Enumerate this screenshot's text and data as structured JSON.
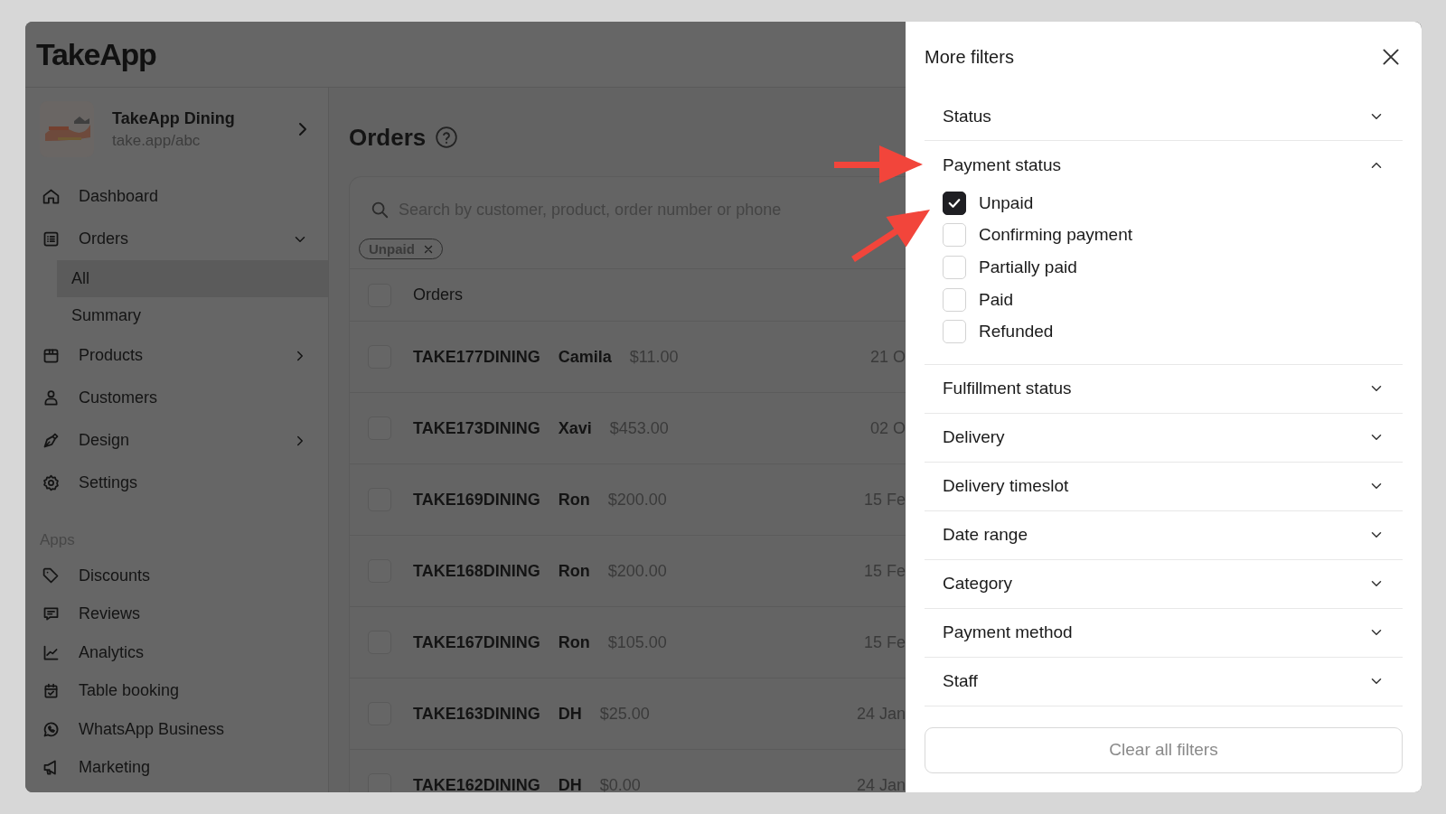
{
  "app": {
    "logo": "TakeApp"
  },
  "store": {
    "name": "TakeApp Dining",
    "url": "take.app/abc"
  },
  "sidebar": {
    "items": [
      {
        "label": "Dashboard",
        "selected": false
      },
      {
        "label": "Orders",
        "selected": false,
        "expanded": true,
        "children": [
          {
            "label": "All",
            "selected": true
          },
          {
            "label": "Summary",
            "selected": false
          }
        ]
      },
      {
        "label": "Products",
        "selected": false,
        "expanded": false
      },
      {
        "label": "Customers",
        "selected": false
      },
      {
        "label": "Design",
        "selected": false,
        "expanded": false
      },
      {
        "label": "Settings",
        "selected": false
      }
    ],
    "apps": {
      "heading": "Apps",
      "items": [
        {
          "label": "Discounts",
          "selected": false
        },
        {
          "label": "Reviews",
          "selected": false
        },
        {
          "label": "Analytics",
          "selected": false
        },
        {
          "label": "Table booking",
          "selected": false
        },
        {
          "label": "WhatsApp Business",
          "selected": false
        },
        {
          "label": "Marketing",
          "selected": false
        }
      ]
    }
  },
  "orders": {
    "title": "Orders",
    "search": {
      "placeholder": "Search by customer, product, order number or phone"
    },
    "chips": [
      {
        "label": "Unpaid"
      }
    ],
    "table": {
      "header": {
        "label": "Orders",
        "checked": false
      },
      "rows": [
        {
          "order": "TAKE177DINING",
          "customer": "Camila",
          "total": "$11.00",
          "date": "21 O",
          "checked": false
        },
        {
          "order": "TAKE173DINING",
          "customer": "Xavi",
          "total": "$453.00",
          "date": "02 O",
          "checked": false
        },
        {
          "order": "TAKE169DINING",
          "customer": "Ron",
          "total": "$200.00",
          "date": "15 Fe",
          "checked": false
        },
        {
          "order": "TAKE168DINING",
          "customer": "Ron",
          "total": "$200.00",
          "date": "15 Fe",
          "checked": false
        },
        {
          "order": "TAKE167DINING",
          "customer": "Ron",
          "total": "$105.00",
          "date": "15 Fe",
          "checked": false
        },
        {
          "order": "TAKE163DINING",
          "customer": "DH",
          "total": "$25.00",
          "date": "24 Jan",
          "checked": false
        },
        {
          "order": "TAKE162DINING",
          "customer": "DH",
          "total": "$0.00",
          "date": "24 Jan",
          "checked": false
        }
      ]
    }
  },
  "drawer": {
    "title": "More filters",
    "sections": [
      {
        "label": "Status",
        "expanded": false
      },
      {
        "label": "Payment status",
        "expanded": true,
        "options": [
          {
            "label": "Unpaid",
            "checked": true
          },
          {
            "label": "Confirming payment",
            "checked": false
          },
          {
            "label": "Partially paid",
            "checked": false
          },
          {
            "label": "Paid",
            "checked": false
          },
          {
            "label": "Refunded",
            "checked": false
          }
        ]
      },
      {
        "label": "Fulfillment status",
        "expanded": false
      },
      {
        "label": "Delivery",
        "expanded": false
      },
      {
        "label": "Delivery timeslot",
        "expanded": false
      },
      {
        "label": "Date range",
        "expanded": false
      },
      {
        "label": "Category",
        "expanded": false
      },
      {
        "label": "Payment method",
        "expanded": false
      },
      {
        "label": "Staff",
        "expanded": false
      }
    ],
    "clear_button": "Clear all filters"
  }
}
